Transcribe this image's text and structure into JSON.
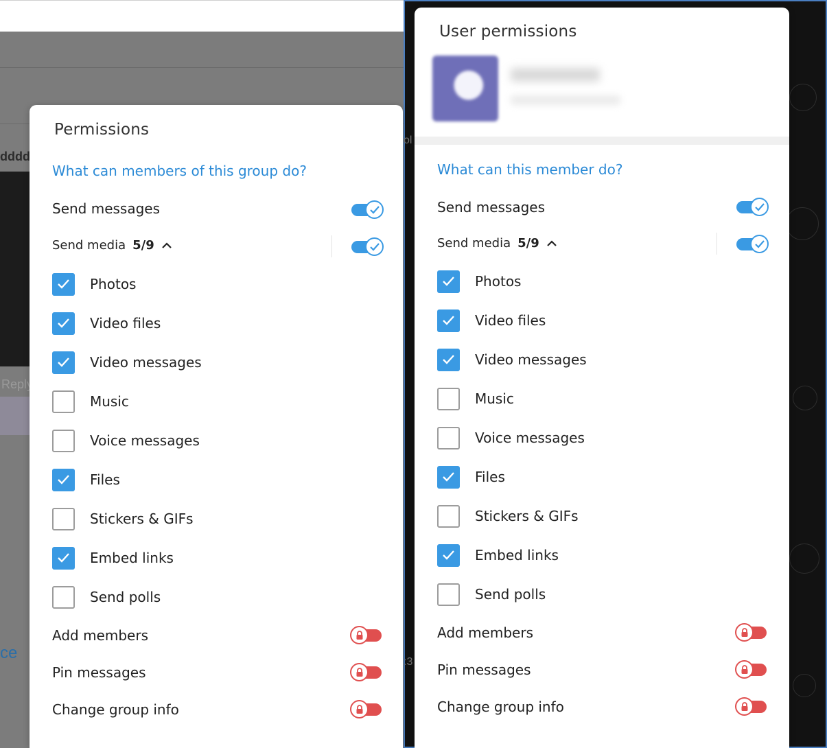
{
  "background": {
    "fragment_ddd": "dddd",
    "fragment_reply": "Reply",
    "fragment_ce": "ce",
    "fragment_ol": "ol",
    "fragment_colon": ":3"
  },
  "group_dialog": {
    "title": "Permissions",
    "section_heading": "What can members of this group do?",
    "send_messages_label": "Send messages",
    "send_media_label": "Send media",
    "send_media_count": "5/9",
    "media_items": [
      {
        "label": "Photos",
        "checked": true
      },
      {
        "label": "Video files",
        "checked": true
      },
      {
        "label": "Video messages",
        "checked": true
      },
      {
        "label": "Music",
        "checked": false
      },
      {
        "label": "Voice messages",
        "checked": false
      },
      {
        "label": "Files",
        "checked": true
      },
      {
        "label": "Stickers & GIFs",
        "checked": false
      },
      {
        "label": "Embed links",
        "checked": true
      },
      {
        "label": "Send polls",
        "checked": false
      }
    ],
    "locked_items": [
      "Add members",
      "Pin messages",
      "Change group info"
    ]
  },
  "user_dialog": {
    "title": "User permissions",
    "section_heading": "What can this member do?",
    "send_messages_label": "Send messages",
    "send_media_label": "Send media",
    "send_media_count": "5/9",
    "media_items": [
      {
        "label": "Photos",
        "checked": true
      },
      {
        "label": "Video files",
        "checked": true
      },
      {
        "label": "Video messages",
        "checked": true
      },
      {
        "label": "Music",
        "checked": false
      },
      {
        "label": "Voice messages",
        "checked": false
      },
      {
        "label": "Files",
        "checked": true
      },
      {
        "label": "Stickers & GIFs",
        "checked": false
      },
      {
        "label": "Embed links",
        "checked": true
      },
      {
        "label": "Send polls",
        "checked": false
      }
    ],
    "locked_items": [
      "Add members",
      "Pin messages",
      "Change group info"
    ]
  },
  "colors": {
    "accent": "#3a9ae3",
    "heading": "#2b8ad6",
    "locked": "#e04f4f"
  }
}
